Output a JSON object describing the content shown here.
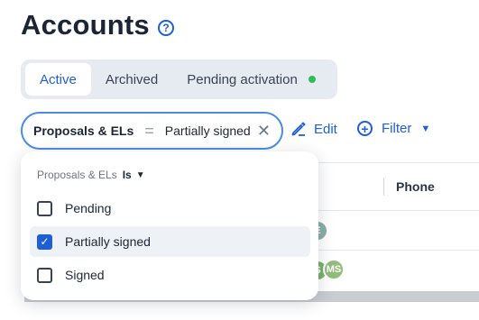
{
  "page": {
    "title": "Accounts",
    "help_icon": "?"
  },
  "tabs": [
    {
      "label": "Active",
      "active": true
    },
    {
      "label": "Archived",
      "active": false
    },
    {
      "label": "Pending activation",
      "active": false,
      "indicator_color": "#2ebd5b"
    }
  ],
  "filter_chip": {
    "field": "Proposals & ELs",
    "operator": "=",
    "value": "Partially signed",
    "clear": "✕"
  },
  "actions": {
    "edit_label": "Edit",
    "filter_label": "Filter"
  },
  "table": {
    "phone_header": "Phone"
  },
  "avatars": [
    "E",
    "S",
    "MS"
  ],
  "dropdown": {
    "field": "Proposals & ELs",
    "operator": "Is",
    "options": [
      {
        "label": "Pending",
        "checked": false
      },
      {
        "label": "Partially signed",
        "checked": true
      },
      {
        "label": "Signed",
        "checked": false
      }
    ]
  }
}
